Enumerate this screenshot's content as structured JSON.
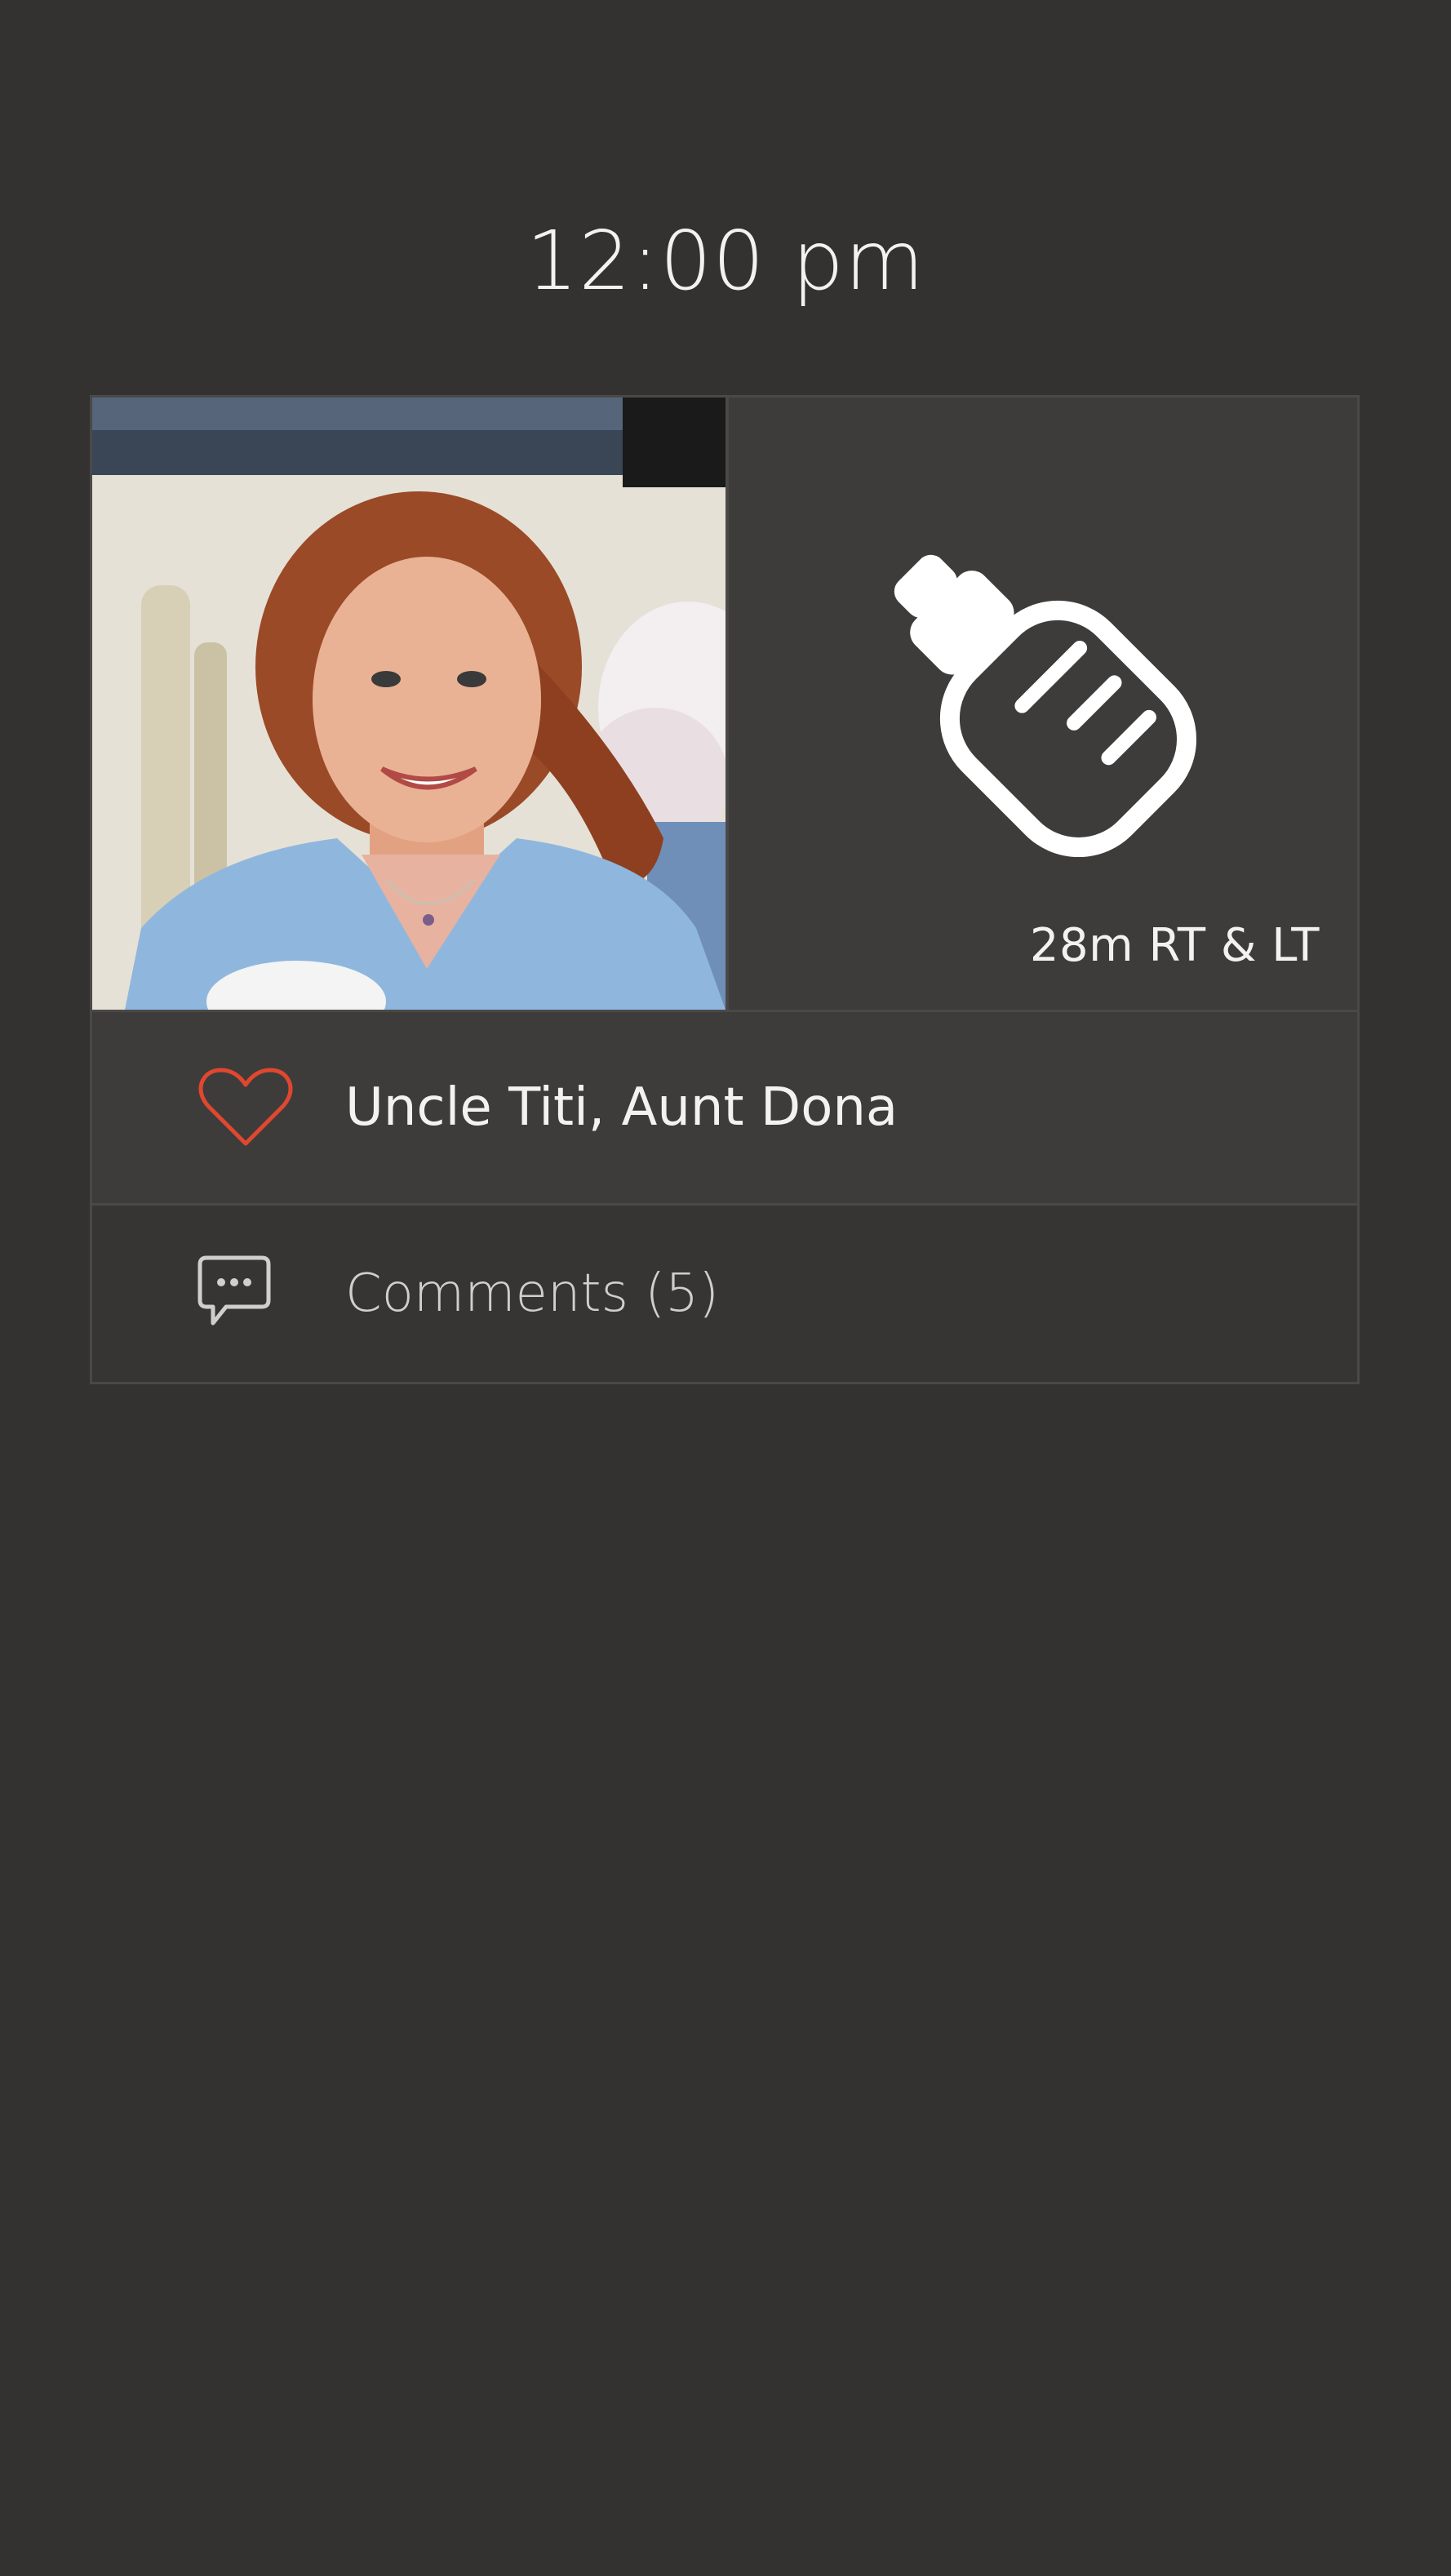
{
  "post": {
    "time": "12:00 pm",
    "activity": {
      "icon": "baby-bottle-icon",
      "label": "28m RT & LT"
    },
    "likes": {
      "icon": "heart-icon",
      "names": "Uncle Titi, Aunt Dona"
    },
    "comments": {
      "icon": "speech-bubble-icon",
      "label": "Comments (5)"
    }
  },
  "colors": {
    "background": "#333231",
    "card": "#3d3c3b",
    "accent_heart": "#e0472f",
    "text": "#f2f2f2"
  }
}
